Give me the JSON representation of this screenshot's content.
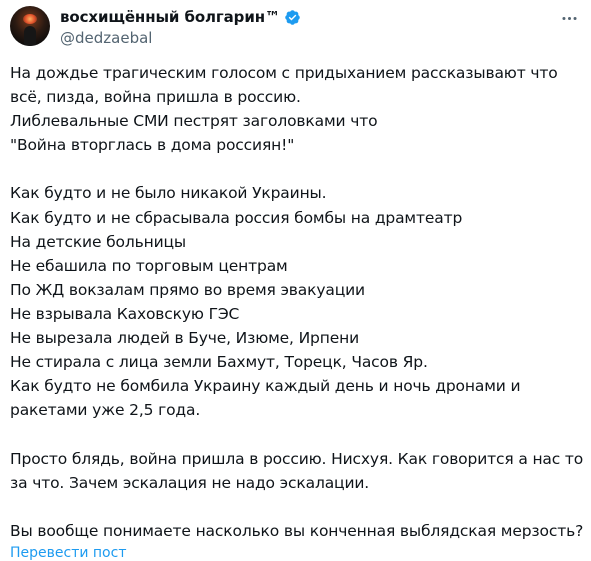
{
  "colors": {
    "text": "#0f1419",
    "secondary": "#536471",
    "accent": "#1d9bf0"
  },
  "author": {
    "display_name": "восхищённый болгарин™",
    "handle": "@dedzaebal",
    "verified_icon": "verified-badge-icon",
    "avatar_icon": "avatar"
  },
  "menu_icon": "more-options-icon",
  "tweet": {
    "lines": [
      "На дождье трагическим голосом с придыханием рассказывают что",
      "всё, пизда, война пришла в россию.",
      "Либлевальные СМИ пестрят заголовками что",
      "\"Война вторглась в дома россиян!\"",
      "",
      "Как будто и не было никакой Украины.",
      "Как будто и не сбрасывала россия бомбы на драмтеатр",
      "На детские больницы",
      "Не ебашила по торговым центрам",
      "По ЖД вокзалам прямо во время эвакуации",
      "Не взрывала Каховскую ГЭС",
      "Не вырезала людей в Буче, Изюме, Ирпени",
      "Не стирала с лица земли Бахмут, Торецк, Часов Яр.",
      "Как будто не бомбила Украину каждый день и ночь дронами и",
      "ракетами уже 2,5 года.",
      "",
      "Просто блядь, война пришла в россию. Нисхуя. Как говорится а нас то",
      "за что. Зачем эскалация не надо эскалации.",
      "",
      "Вы вообще понимаете насколько вы конченная выблядская мерзость?"
    ],
    "translate_label": "Перевести пост"
  }
}
